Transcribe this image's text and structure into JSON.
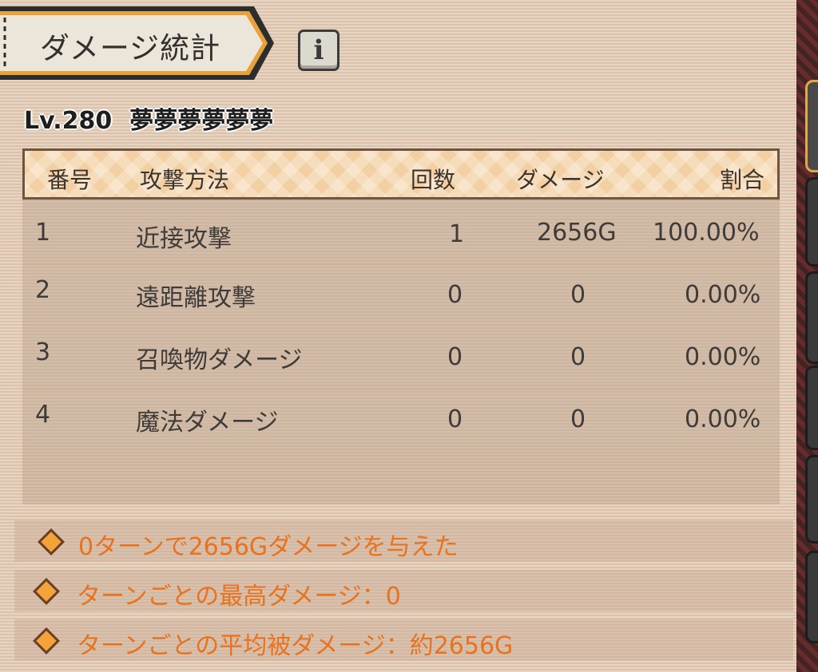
{
  "title": "ダメージ統計",
  "info_icon": "i",
  "player": {
    "level": "Lv.280",
    "name": "夢夢夢夢夢夢"
  },
  "table": {
    "headers": [
      "番号",
      "攻撃方法",
      "回数",
      "ダメージ",
      "割合"
    ],
    "rows": [
      {
        "no": "1",
        "method": "近接攻撃",
        "count": "1",
        "damage": "2656G",
        "ratio": "100.00%"
      },
      {
        "no": "2",
        "method": "遠距離攻撃",
        "count": "0",
        "damage": "0",
        "ratio": "0.00%"
      },
      {
        "no": "3",
        "method": "召喚物ダメージ",
        "count": "0",
        "damage": "0",
        "ratio": "0.00%"
      },
      {
        "no": "4",
        "method": "魔法ダメージ",
        "count": "0",
        "damage": "0",
        "ratio": "0.00%"
      }
    ]
  },
  "summary": [
    "0ターンで2656Gダメージを与えた",
    "ターンごとの最高ダメージ：0",
    "ターンごとの平均被ダメージ：約2656G"
  ],
  "colors": {
    "accent": "#e8721e",
    "banner_border": "#e7a33a",
    "header_bg": "#f2d0a4"
  }
}
